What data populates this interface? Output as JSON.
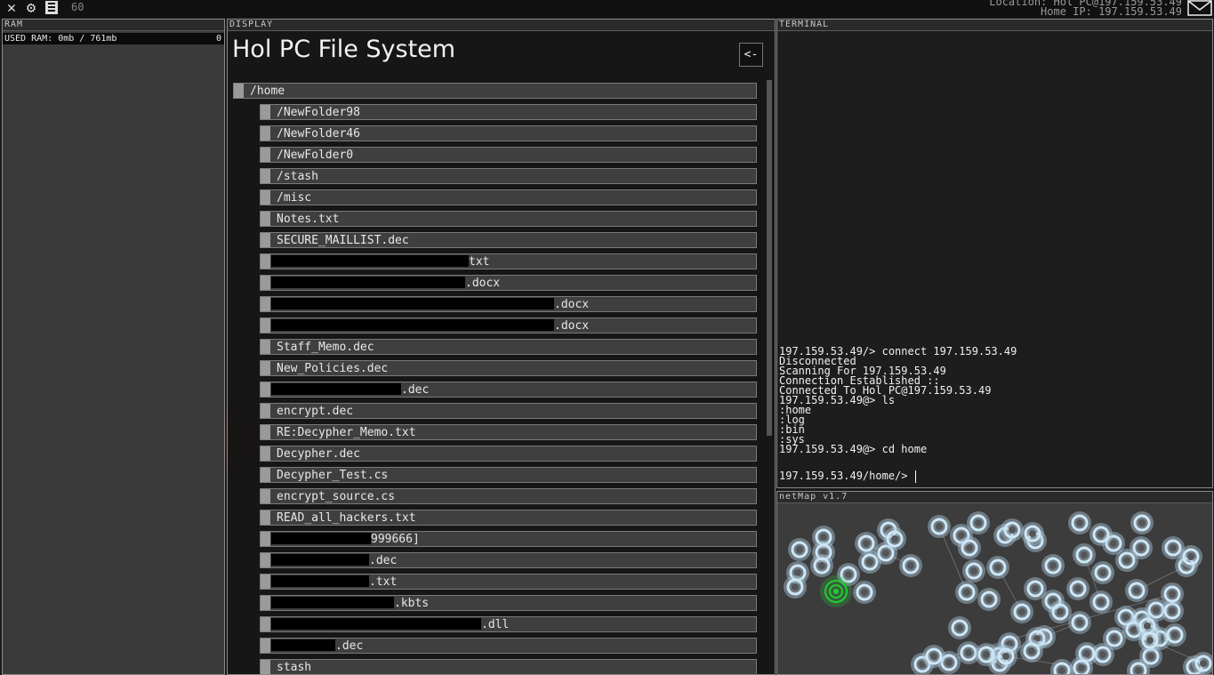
{
  "topbar": {
    "fps": "60",
    "location": "Location: Hol PC@197.159.53.49",
    "home_ip": "Home IP: 197.159.53.49",
    "icons": [
      "close-icon",
      "gear-icon",
      "save-icon",
      "mail-icon"
    ]
  },
  "ram": {
    "title": "RAM",
    "used_label": "USED RAM: 0mb / 761mb",
    "count": "0"
  },
  "display": {
    "title": "DISPLAY",
    "heading": "Hol PC File System",
    "back_label": "<-",
    "items": [
      {
        "label": "/home",
        "type": "folder",
        "depth": 0
      },
      {
        "label": "/NewFolder98",
        "type": "folder",
        "depth": 1
      },
      {
        "label": "/NewFolder46",
        "type": "folder",
        "depth": 1
      },
      {
        "label": "/NewFolder0",
        "type": "folder",
        "depth": 1
      },
      {
        "label": "/stash",
        "type": "folder",
        "depth": 1
      },
      {
        "label": "/misc",
        "type": "folder",
        "depth": 1
      },
      {
        "label": "Notes.txt",
        "type": "file",
        "depth": 1
      },
      {
        "label": "SECURE_MAILLIST.dec",
        "type": "file",
        "depth": 1
      },
      {
        "label": "txt",
        "type": "redacted",
        "depth": 1
      },
      {
        "label": ".docx",
        "type": "redacted",
        "depth": 1
      },
      {
        "label": ".docx",
        "type": "redacted",
        "depth": 1
      },
      {
        "label": ".docx",
        "type": "redacted",
        "depth": 1
      },
      {
        "label": "Staff_Memo.dec",
        "type": "file",
        "depth": 1
      },
      {
        "label": "New_Policies.dec",
        "type": "file",
        "depth": 1
      },
      {
        "label": ".dec",
        "type": "redacted",
        "depth": 1
      },
      {
        "label": "encrypt.dec",
        "type": "file",
        "depth": 1
      },
      {
        "label": "RE:Decypher_Memo.txt",
        "type": "file",
        "depth": 1
      },
      {
        "label": "Decypher.dec",
        "type": "file",
        "depth": 1
      },
      {
        "label": "Decypher_Test.cs",
        "type": "file",
        "depth": 1
      },
      {
        "label": "encrypt_source.cs",
        "type": "file",
        "depth": 1
      },
      {
        "label": "READ_all_hackers.txt",
        "type": "file",
        "depth": 1
      },
      {
        "label": "999666]",
        "type": "redacted",
        "depth": 1
      },
      {
        "label": ".dec",
        "type": "redacted",
        "depth": 1
      },
      {
        "label": ".txt",
        "type": "redacted",
        "depth": 1
      },
      {
        "label": ".kbts",
        "type": "redacted",
        "depth": 1
      },
      {
        "label": ".dll",
        "type": "redacted",
        "depth": 1
      },
      {
        "label": ".dec",
        "type": "redacted",
        "depth": 1
      },
      {
        "label": "stash",
        "type": "file",
        "depth": 1
      }
    ]
  },
  "terminal": {
    "title": "TERMINAL",
    "lines": [
      "197.159.53.49/> connect 197.159.53.49",
      "Disconnected",
      "Scanning For 197.159.53.49",
      "Connection Established ::",
      "Connected To Hol PC@197.159.53.49",
      "197.159.53.49@> ls",
      ":home",
      ":log",
      ":bin",
      ":sys",
      "197.159.53.49@> cd home",
      ""
    ],
    "prompt": "197.159.53.49/home/>"
  },
  "netmap": {
    "title": "netMap v1.7"
  },
  "colors": {
    "background": "#1a1a1a",
    "panel_border": "#8a8a8a",
    "node": "#cfe6f5",
    "node_active": "#22cc33"
  }
}
